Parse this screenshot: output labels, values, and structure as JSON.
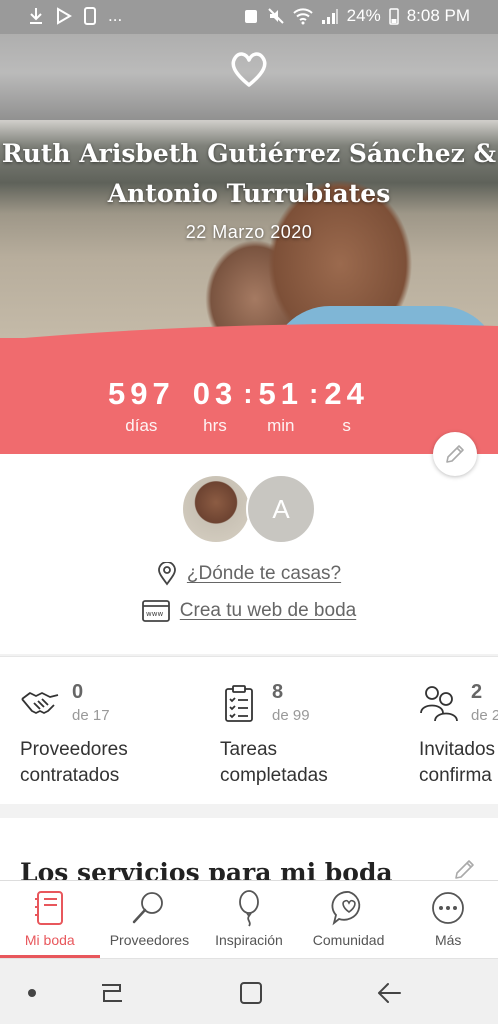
{
  "status_bar": {
    "left_icons": [
      "download-icon",
      "play-store-icon",
      "sim-icon",
      "more-dots"
    ],
    "left_more": "...",
    "battery": "24%",
    "time": "8:08 PM"
  },
  "hero": {
    "couple_line1": "Ruth Arisbeth Gutiérrez Sánchez &",
    "couple_line2": "Antonio Turrubiates",
    "date": "22 Marzo 2020"
  },
  "countdown": {
    "days": "597",
    "days_label": "días",
    "hours": "03",
    "hours_label": "hrs",
    "minutes": "51",
    "minutes_label": "min",
    "seconds": "24",
    "seconds_label": "s",
    "separator": ":"
  },
  "profile": {
    "avatar_letter": "A",
    "location_link": "¿Dónde te casas?",
    "web_link": "Crea tu web de boda"
  },
  "stats": [
    {
      "count": "0",
      "total": "de 17",
      "label_line1": "Proveedores",
      "label_line2": "contratados"
    },
    {
      "count": "8",
      "total": "de 99",
      "label_line1": "Tareas",
      "label_line2": "completadas"
    },
    {
      "count": "2",
      "total": "de 2",
      "label_line1": "Invitados",
      "label_line2": "confirma"
    }
  ],
  "services": {
    "title": "Los servicios para mi boda"
  },
  "bottom_nav": [
    {
      "label": "Mi boda",
      "icon": "notebook-icon",
      "active": true
    },
    {
      "label": "Proveedores",
      "icon": "search-icon",
      "active": false
    },
    {
      "label": "Inspiración",
      "icon": "balloon-icon",
      "active": false
    },
    {
      "label": "Comunidad",
      "icon": "chat-heart-icon",
      "active": false
    },
    {
      "label": "Más",
      "icon": "more-icon",
      "active": false
    }
  ],
  "colors": {
    "accent": "#f06b6e",
    "active_nav": "#e8575c"
  }
}
